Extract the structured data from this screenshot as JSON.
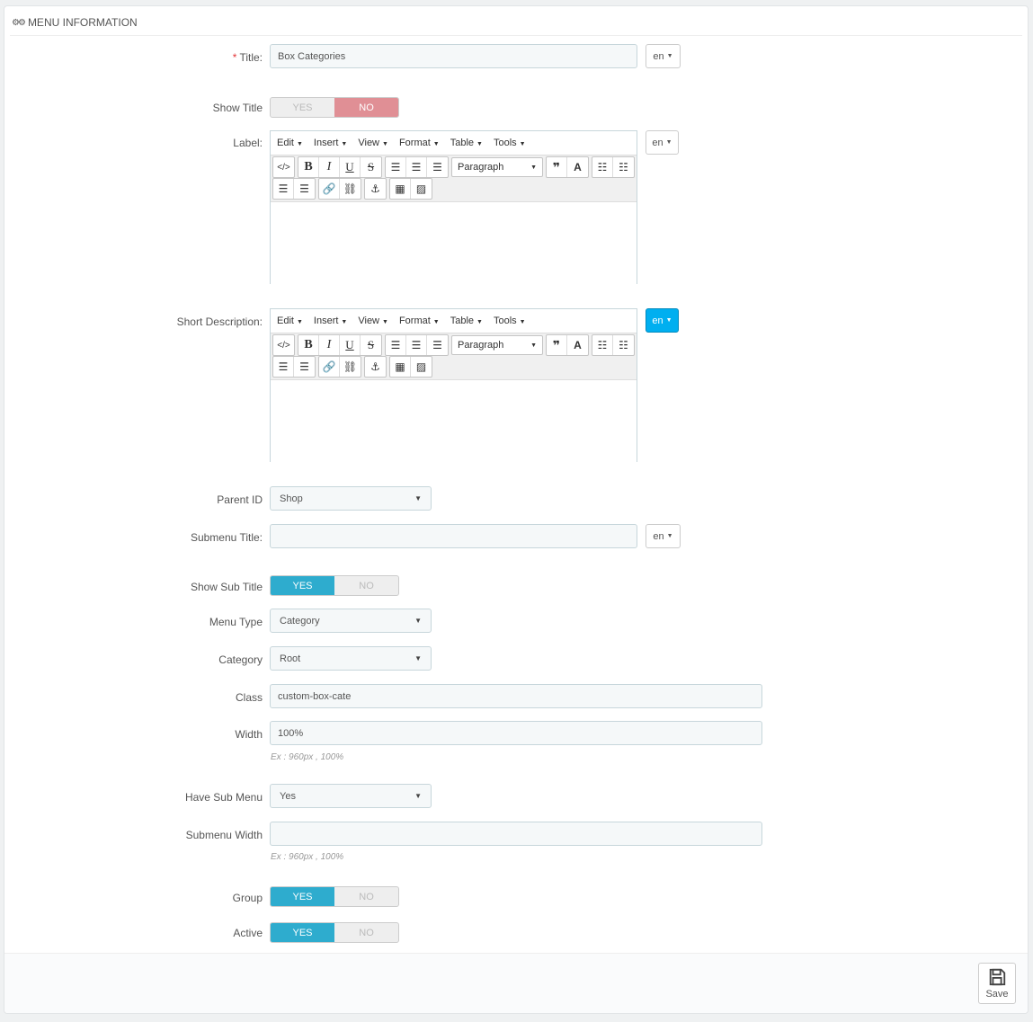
{
  "panel": {
    "title": "Menu information"
  },
  "fields": {
    "title": {
      "label": "Title:",
      "required_mark": "*",
      "value": "Box Categories",
      "lang": "en"
    },
    "show_title": {
      "label": "Show Title",
      "yes": "YES",
      "no": "NO",
      "value": "no"
    },
    "label": {
      "label": "Label:",
      "lang": "en"
    },
    "short_description": {
      "label": "Short Description:",
      "lang": "en"
    },
    "parent_id": {
      "label": "Parent ID",
      "value": "Shop"
    },
    "submenu_title": {
      "label": "Submenu Title:",
      "value": "",
      "lang": "en"
    },
    "show_sub_title": {
      "label": "Show Sub Title",
      "yes": "YES",
      "no": "NO",
      "value": "yes"
    },
    "menu_type": {
      "label": "Menu Type",
      "value": "Category"
    },
    "category": {
      "label": "Category",
      "value": "Root"
    },
    "class": {
      "label": "Class",
      "value": "custom-box-cate"
    },
    "width": {
      "label": "Width",
      "value": "100%",
      "hint": "Ex : 960px , 100%"
    },
    "have_sub_menu": {
      "label": "Have Sub Menu",
      "value": "Yes"
    },
    "submenu_width": {
      "label": "Submenu Width",
      "value": "",
      "hint": "Ex : 960px , 100%"
    },
    "group": {
      "label": "Group",
      "yes": "YES",
      "no": "NO",
      "value": "yes"
    },
    "active": {
      "label": "Active",
      "yes": "YES",
      "no": "NO",
      "value": "yes"
    }
  },
  "editor": {
    "menus": [
      "Edit",
      "Insert",
      "View",
      "Format",
      "Table",
      "Tools"
    ],
    "block_format": "Paragraph",
    "icons": [
      "source-code-icon",
      "bold-icon",
      "italic-icon",
      "underline-icon",
      "strikethrough-icon",
      "align-left-icon",
      "align-center-icon",
      "align-right-icon",
      "blockquote-icon",
      "text-color-icon",
      "bullet-list-icon",
      "numbered-list-icon",
      "outdent-icon",
      "indent-icon",
      "link-icon",
      "unlink-icon",
      "anchor-icon",
      "media-icon",
      "image-icon"
    ]
  },
  "footer": {
    "save_label": "Save"
  },
  "colors": {
    "accent": "#2eacce",
    "no_active": "#e08f95",
    "lang_active": "#00aff0",
    "required": "#e3373a"
  }
}
